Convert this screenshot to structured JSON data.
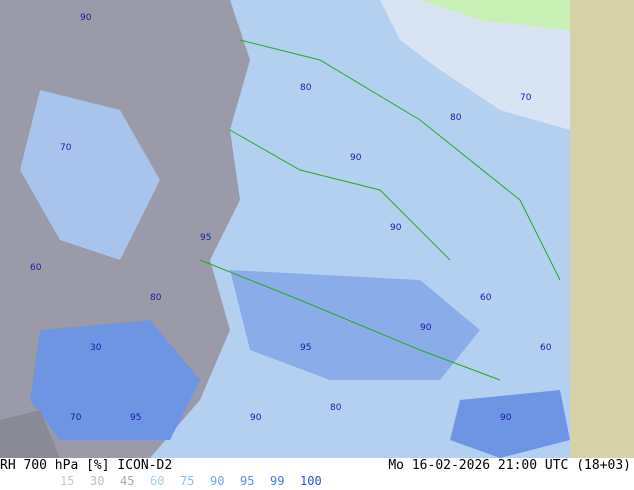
{
  "footer": {
    "title": "RH 700 hPa [%] ICON-D2",
    "datetime": "Mo 16-02-2026 21:00 UTC (18+03)"
  },
  "legend": [
    {
      "label": "15",
      "color": "#c8c8c8"
    },
    {
      "label": "30",
      "color": "#bdbdbd"
    },
    {
      "label": "45",
      "color": "#a8a8a8"
    },
    {
      "label": "60",
      "color": "#a0d0e8"
    },
    {
      "label": "75",
      "color": "#8cbce8"
    },
    {
      "label": "90",
      "color": "#78a8e8"
    },
    {
      "label": "95",
      "color": "#5a8ce8"
    },
    {
      "label": "99",
      "color": "#4678e8"
    },
    {
      "label": "100",
      "color": "#2850e0"
    }
  ],
  "contour_labels": [
    "90",
    "80",
    "70",
    "60",
    "95",
    "90",
    "80",
    "70",
    "90",
    "95",
    "60",
    "30",
    "80",
    "90",
    "70",
    "95",
    "90",
    "80",
    "60",
    "90"
  ]
}
